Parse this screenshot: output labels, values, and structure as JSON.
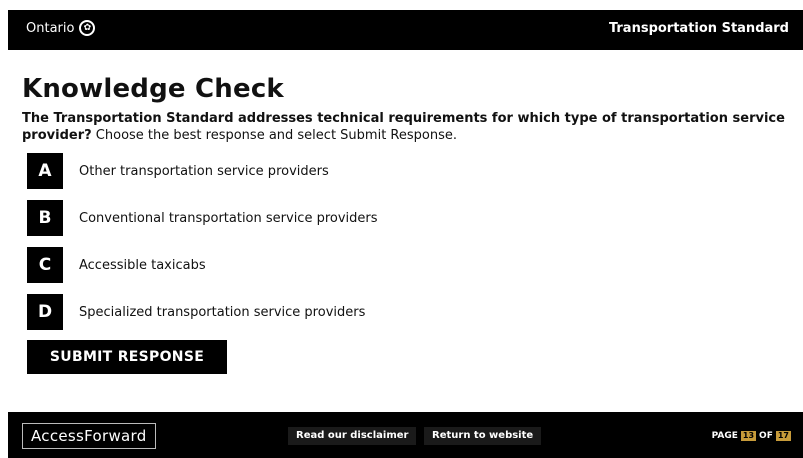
{
  "header": {
    "brand": "Ontario",
    "brand_icon": "trillium-logo-icon",
    "title": "Transportation Standard"
  },
  "main": {
    "heading": "Knowledge Check",
    "question_bold": "The Transportation Standard addresses technical requirements for which type of transportation service provider?",
    "question_instruction": "Choose the best response and select Submit Response.",
    "options": [
      {
        "letter": "A",
        "text": "Other transportation service providers"
      },
      {
        "letter": "B",
        "text": "Conventional transportation service providers"
      },
      {
        "letter": "C",
        "text": "Accessible taxicabs"
      },
      {
        "letter": "D",
        "text": "Specialized transportation service providers"
      }
    ],
    "submit_label": "SUBMIT RESPONSE"
  },
  "footer": {
    "logo_text": "AccessForward",
    "disclaimer_label": "Read our disclaimer",
    "return_label": "Return to website",
    "page_prefix": "PAGE",
    "page_current": "13",
    "page_of": "OF",
    "page_total": "17",
    "page_number_color": "#c79b3a"
  }
}
